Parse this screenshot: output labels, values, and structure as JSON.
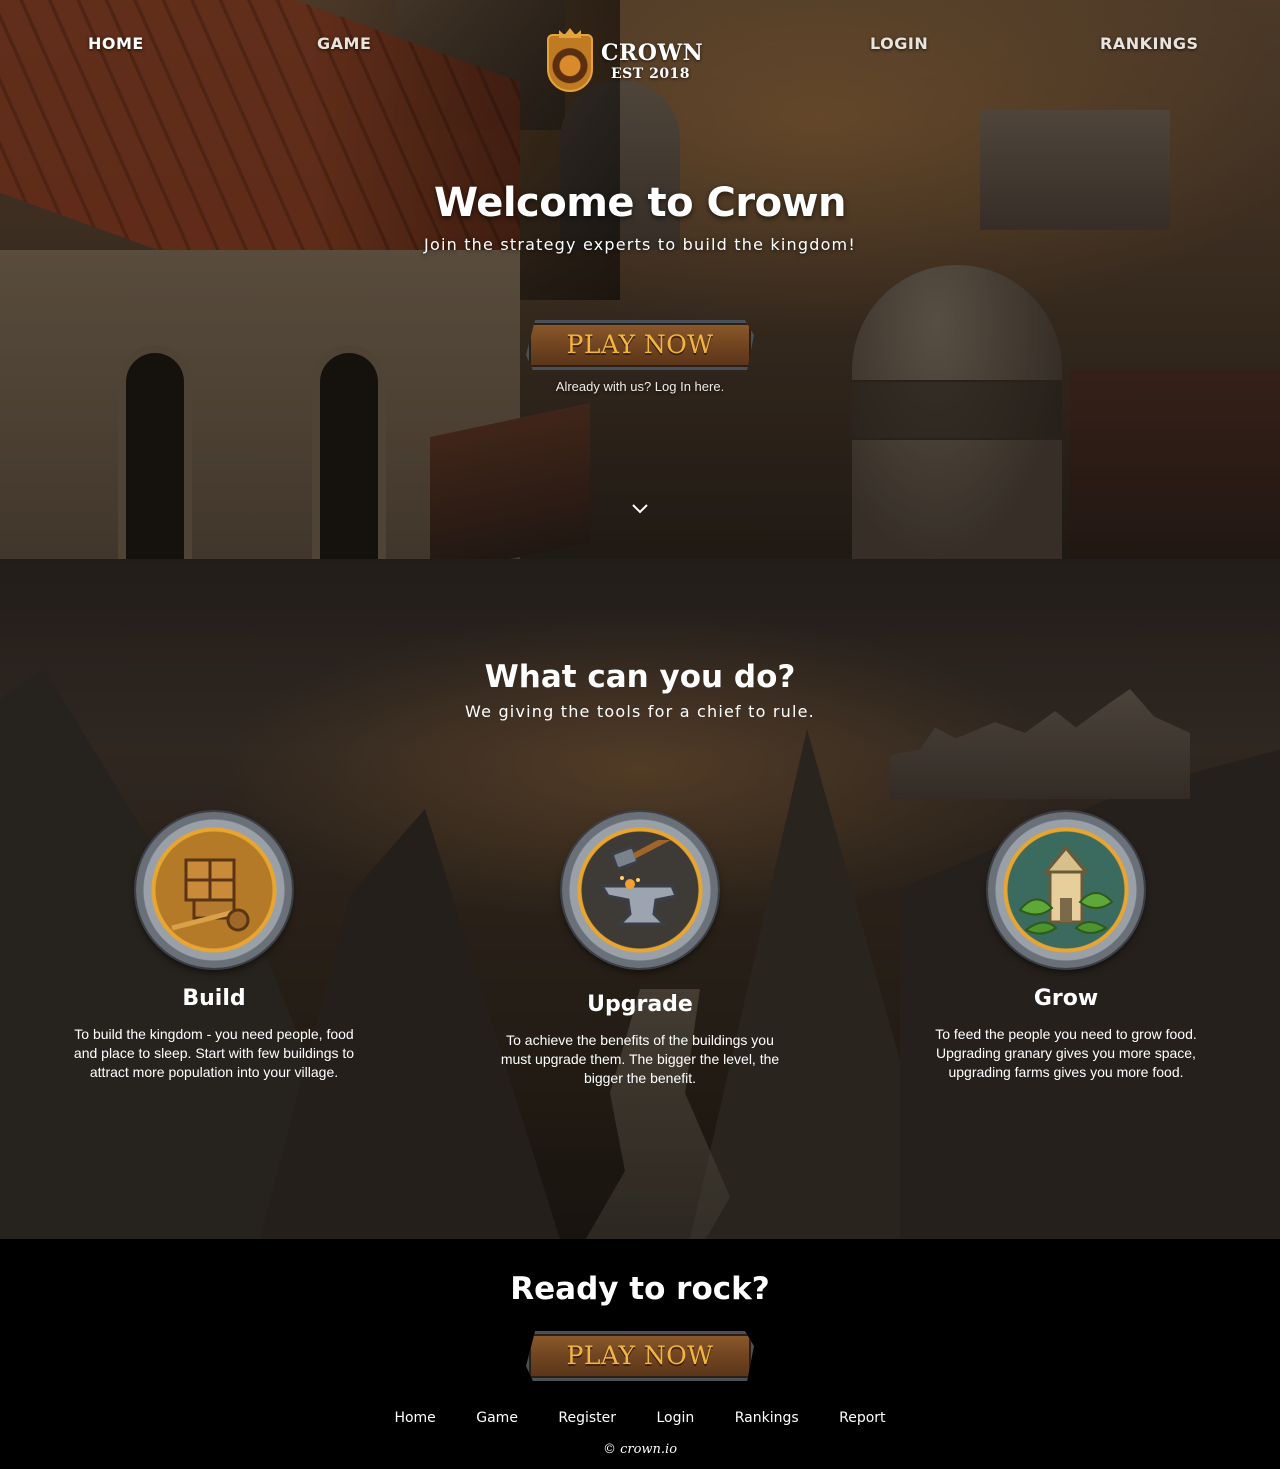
{
  "nav": {
    "home": "HOME",
    "game": "GAME",
    "login": "LOGIN",
    "rankings": "RANKINGS"
  },
  "logo": {
    "title": "CROWN",
    "subtitle": "EST 2018",
    "icon": "lion-crest-icon"
  },
  "hero": {
    "title": "Welcome to Crown",
    "subtitle": "Join the strategy experts to build the kingdom!",
    "play_label": "PLAY NOW",
    "login_hint": "Already with us? Log In here.",
    "scroll_icon": "chevron-down-icon"
  },
  "features": {
    "title": "What can you do?",
    "subtitle": "We giving the tools for a chief to rule.",
    "items": [
      {
        "title": "Build",
        "text": "To build the kingdom - you need people, food and place to sleep. Start with few buildings to attract more population into your village.",
        "icon": "construction-crate-icon"
      },
      {
        "title": "Upgrade",
        "text": "To achieve the benefits of the buildings you must upgrade them. The bigger the level, the bigger the benefit.",
        "icon": "anvil-hammer-icon"
      },
      {
        "title": "Grow",
        "text": "To feed the people you need to grow food. Upgrading granary gives you more space, upgrading farms gives you more food.",
        "icon": "granary-tower-icon"
      }
    ]
  },
  "cta": {
    "title": "Ready to rock?",
    "play_label": "PLAY NOW"
  },
  "footer": {
    "links": [
      "Home",
      "Game",
      "Register",
      "Login",
      "Rankings",
      "Report"
    ],
    "copyright": "© crown.io"
  },
  "colors": {
    "button_text": "#f2b540",
    "button_wood": "#6e4320",
    "badge_gold": "#e8a630"
  }
}
